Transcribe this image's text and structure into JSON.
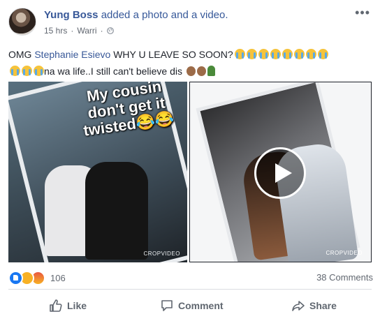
{
  "post": {
    "author": "Yung Boss",
    "action_text": "added a photo and a video.",
    "timestamp": "15 hrs",
    "location": "Warri",
    "separator": "·",
    "text_start": "OMG ",
    "mention": "Stephanie Esievo",
    "text_mid": " WHY U LEAVE SO SOON?",
    "text_end": "na wa life..I still can't believe dis",
    "emoji_line1_cry_count": 8,
    "emoji_line2_cry_count": 3
  },
  "media": {
    "photo_caption": "My cousin don't get it twisted😂😂",
    "photo_watermark": "CROPVIDEO",
    "video_watermark": "CROPVIDEO"
  },
  "reactions": {
    "types": [
      "like",
      "sad",
      "angry"
    ],
    "count": "106",
    "comments": "38 Comments"
  },
  "actions": {
    "like": "Like",
    "comment": "Comment",
    "share": "Share"
  },
  "icons": {
    "more": "more-options-icon",
    "privacy": "globe-icon",
    "play": "play-icon"
  },
  "colors": {
    "link": "#385898",
    "muted": "#616770",
    "like_blue": "#1877f2"
  }
}
